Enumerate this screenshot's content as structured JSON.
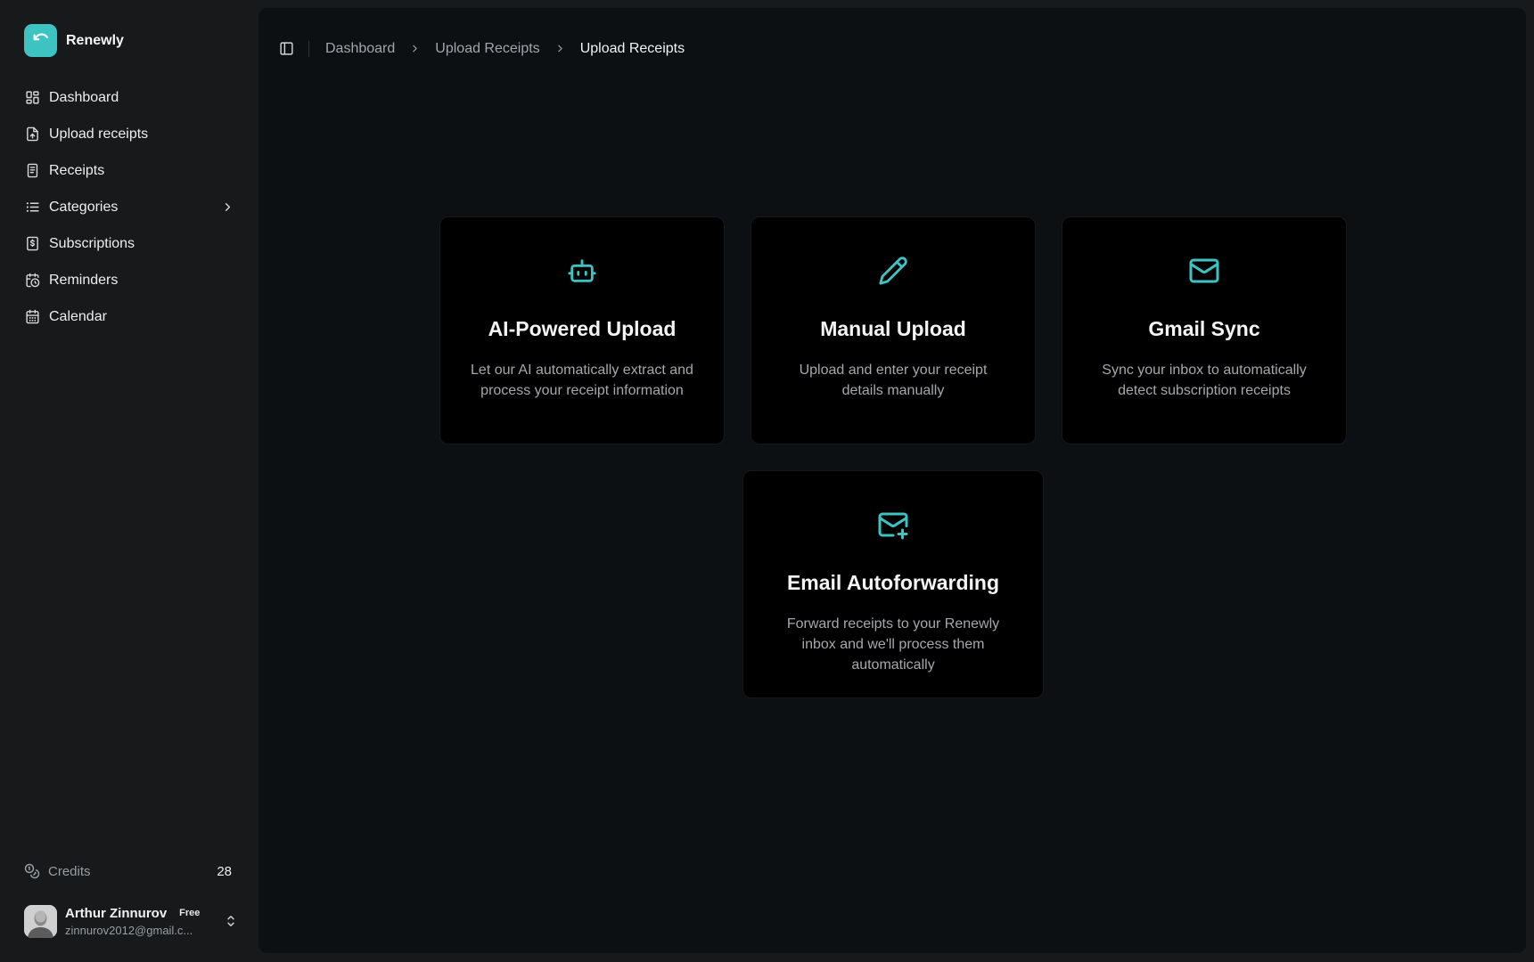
{
  "brand": {
    "name": "Renewly",
    "color": "#3ec3c3"
  },
  "sidebar": {
    "items": [
      {
        "label": "Dashboard",
        "icon": "dashboard-icon"
      },
      {
        "label": "Upload receipts",
        "icon": "file-upload-icon"
      },
      {
        "label": "Receipts",
        "icon": "receipt-icon"
      },
      {
        "label": "Categories",
        "icon": "list-icon",
        "has_submenu": true
      },
      {
        "label": "Subscriptions",
        "icon": "dollar-file-icon"
      },
      {
        "label": "Reminders",
        "icon": "calendar-clock-icon"
      },
      {
        "label": "Calendar",
        "icon": "calendar-icon"
      }
    ],
    "credits": {
      "label": "Credits",
      "value": "28",
      "icon": "coins-icon"
    },
    "user": {
      "name": "Arthur Zinnurov",
      "plan": "Free",
      "email": "zinnurov2012@gmail.c..."
    }
  },
  "topbar": {
    "toggle_icon": "sidebar-toggle-icon",
    "breadcrumbs": [
      "Dashboard",
      "Upload Receipts",
      "Upload Receipts"
    ]
  },
  "cards": [
    {
      "icon": "bot-icon",
      "title": "AI-Powered Upload",
      "description": "Let our AI automatically extract and process your receipt information"
    },
    {
      "icon": "pencil-icon",
      "title": "Manual Upload",
      "description": "Upload and enter your receipt details manually"
    },
    {
      "icon": "mail-icon",
      "title": "Gmail Sync",
      "description": "Sync your inbox to automatically detect subscription receipts"
    },
    {
      "icon": "mail-plus-icon",
      "title": "Email Autoforwarding",
      "description": "Forward receipts to your Renewly inbox and we'll process them automatically"
    }
  ],
  "colors": {
    "accent": "#3ec3c3",
    "sidebar_bg": "#17191b",
    "main_bg": "#0d1012",
    "card_bg": "#000000"
  }
}
